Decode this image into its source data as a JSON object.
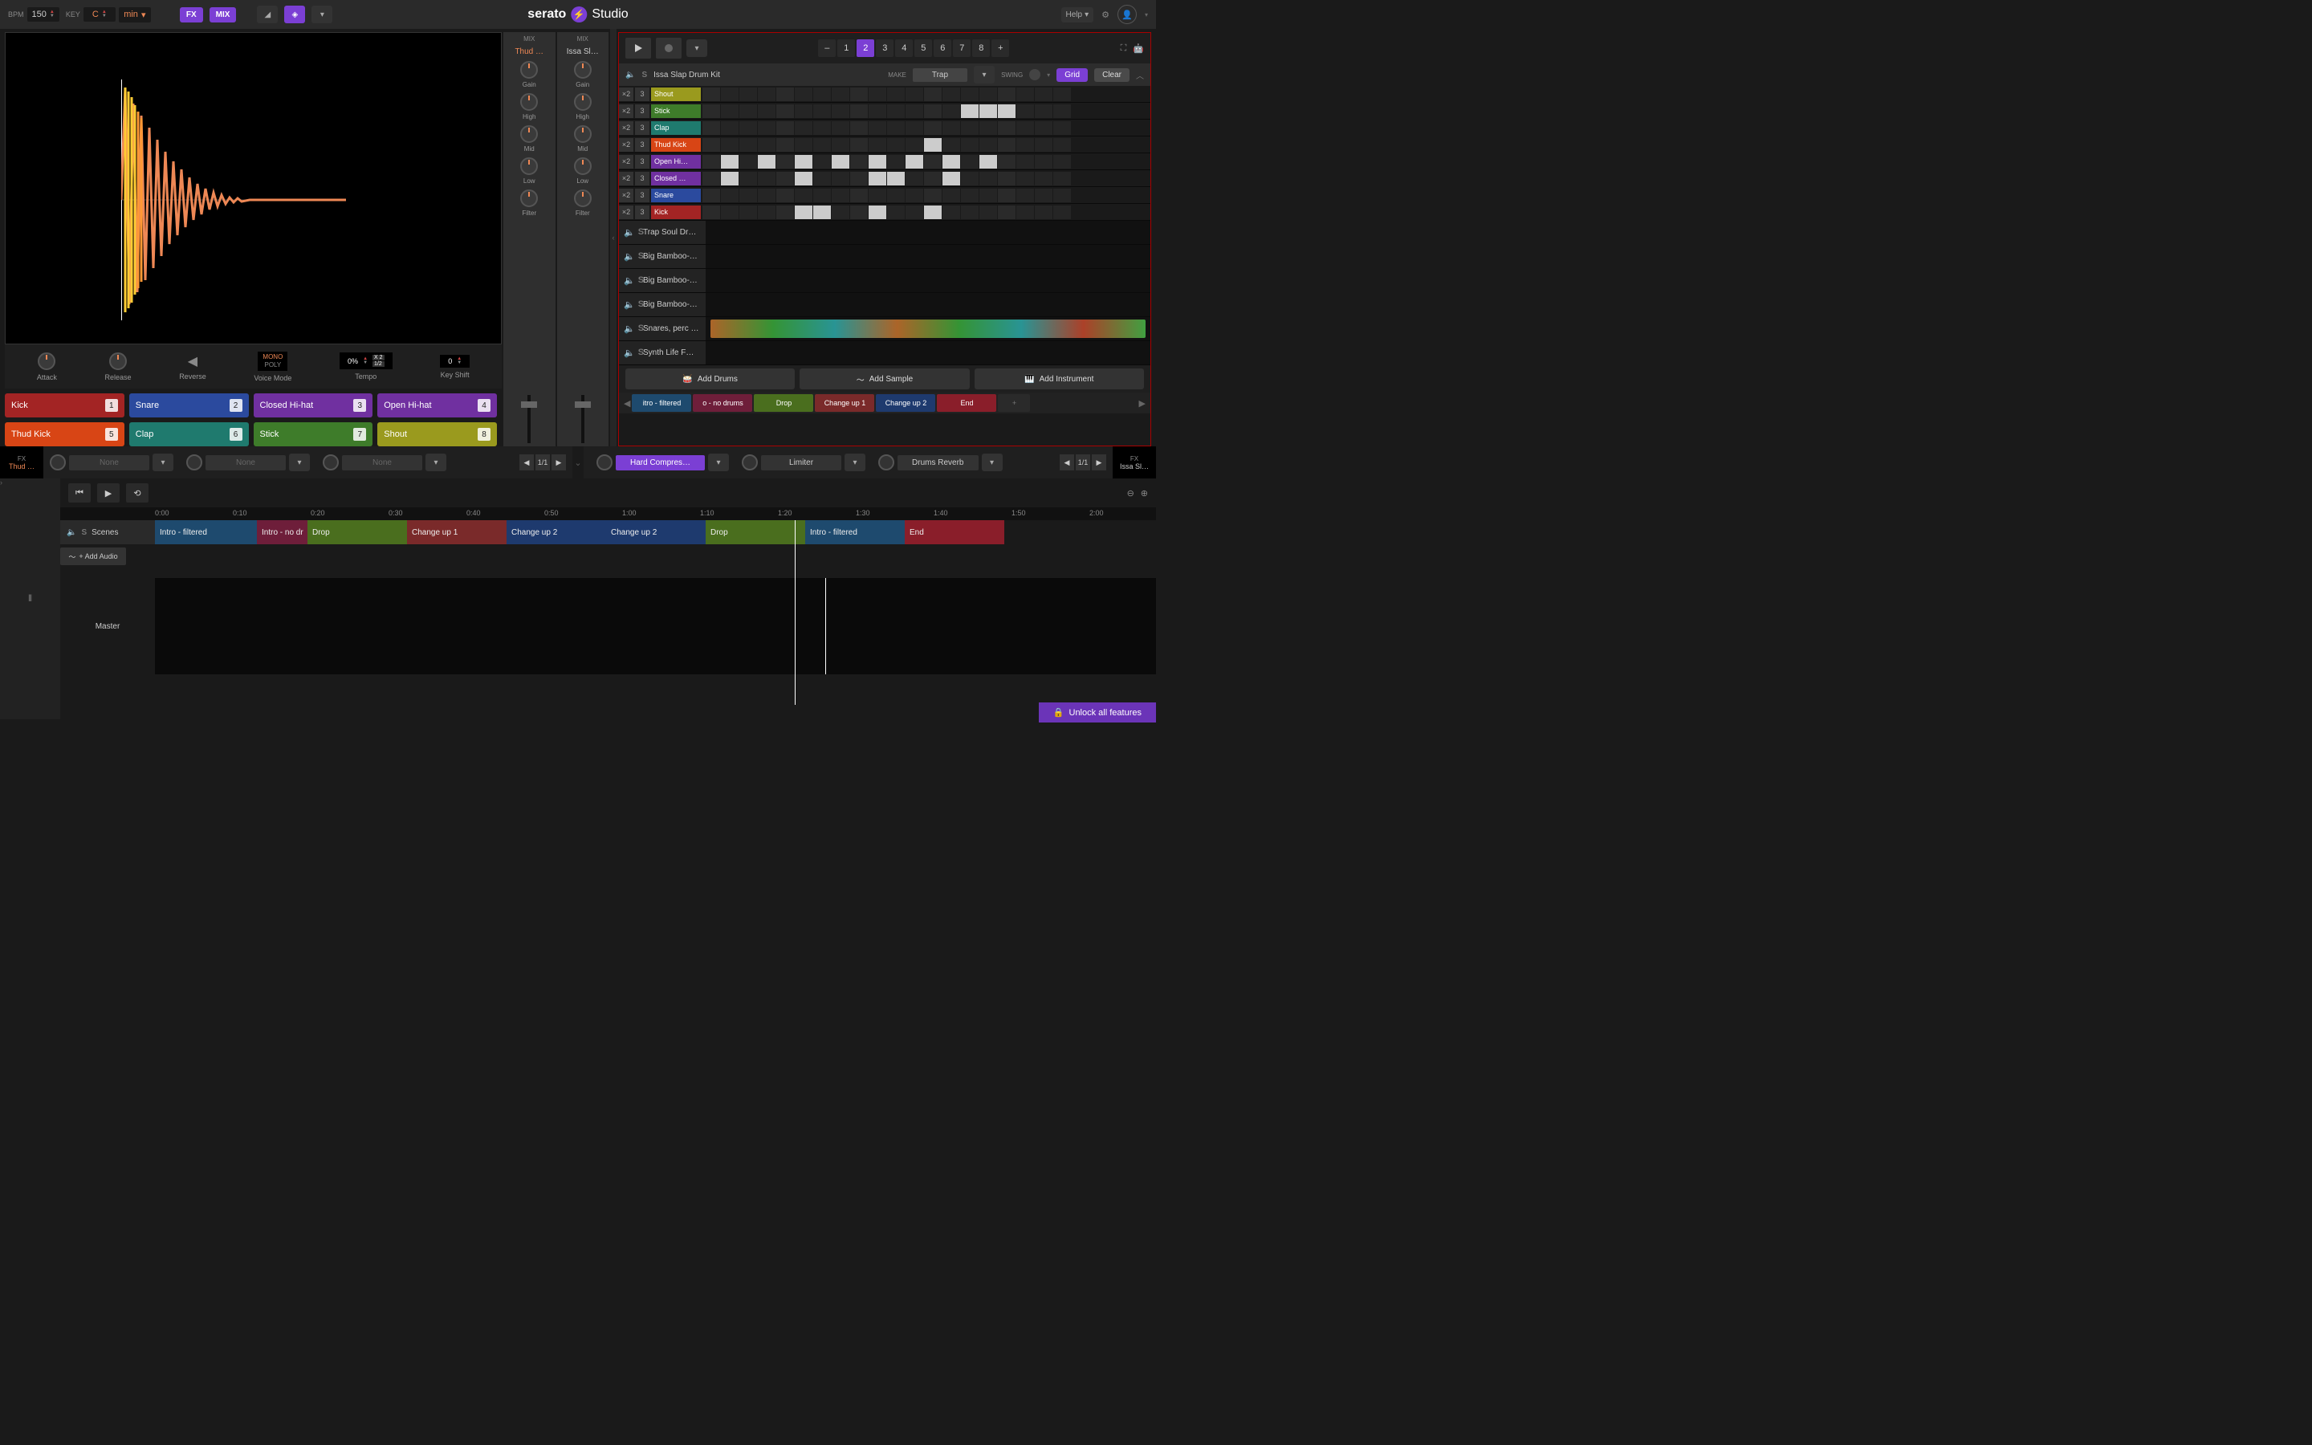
{
  "top": {
    "bpm_label": "BPM",
    "bpm_value": "150",
    "key_label": "KEY",
    "key_value": "C",
    "key_scale": "min",
    "fx": "FX",
    "mix": "MIX",
    "brand": "serato",
    "product": "Studio",
    "help": "Help"
  },
  "sample": {
    "attack": "Attack",
    "release": "Release",
    "reverse": "Reverse",
    "voice": "Voice Mode",
    "mono": "MONO",
    "poly": "POLY",
    "tempo": "Tempo",
    "tempo_val": "0%",
    "x2": "X 2",
    "half": "1/2",
    "keyshift": "Key Shift",
    "keyshift_val": "0"
  },
  "pads": [
    {
      "label": "Kick",
      "num": "1",
      "color": "#a32424"
    },
    {
      "label": "Snare",
      "num": "2",
      "color": "#2b4a9e"
    },
    {
      "label": "Closed Hi-hat",
      "num": "3",
      "color": "#7030a0"
    },
    {
      "label": "Open Hi-hat",
      "num": "4",
      "color": "#7030a0"
    },
    {
      "label": "Thud Kick",
      "num": "5",
      "color": "#d84515"
    },
    {
      "label": "Clap",
      "num": "6",
      "color": "#1f7a6e"
    },
    {
      "label": "Stick",
      "num": "7",
      "color": "#3e7c2a"
    },
    {
      "label": "Shout",
      "num": "8",
      "color": "#9a9a1e"
    }
  ],
  "strips": [
    {
      "mix": "MIX",
      "name": "Thud …",
      "red": true
    },
    {
      "mix": "MIX",
      "name": "Issa Sl…",
      "red": false
    }
  ],
  "strip_knobs": [
    "Gain",
    "High",
    "Mid",
    "Low",
    "Filter"
  ],
  "transport": {
    "scenes": [
      "1",
      "2",
      "3",
      "4",
      "5",
      "6",
      "7",
      "8"
    ],
    "active": "2",
    "minus": "–",
    "plus": "+"
  },
  "drumkit": {
    "name": "Issa Slap Drum Kit",
    "make": "MAKE",
    "genre": "Trap",
    "swing": "SWING",
    "grid": "Grid",
    "clear": "Clear"
  },
  "drum_rows": [
    {
      "label": "Shout",
      "color": "#9a9a1e",
      "steps": []
    },
    {
      "label": "Stick",
      "color": "#3e7c2a",
      "steps": [
        15,
        16,
        17
      ]
    },
    {
      "label": "Clap",
      "color": "#1f7a6e",
      "steps": []
    },
    {
      "label": "Thud Kick",
      "color": "#d84515",
      "steps": [
        13
      ]
    },
    {
      "label": "Open Hi…",
      "color": "#7030a0",
      "steps": [
        2,
        4,
        6,
        8,
        10,
        12,
        14,
        16
      ]
    },
    {
      "label": "Closed …",
      "color": "#7030a0",
      "steps": [
        2,
        6,
        10,
        11,
        14
      ]
    },
    {
      "label": "Snare",
      "color": "#2b4a9e",
      "steps": []
    },
    {
      "label": "Kick",
      "color": "#a32424",
      "steps": [
        6,
        7,
        10,
        13
      ]
    }
  ],
  "tracks": [
    {
      "name": "Trap Soul Dr…"
    },
    {
      "name": "Big Bamboo-…"
    },
    {
      "name": "Big Bamboo-…"
    },
    {
      "name": "Big Bamboo-…"
    },
    {
      "name": "Snares, perc …",
      "wave": true
    },
    {
      "name": "Synth Life F…"
    }
  ],
  "add": {
    "drums": "Add Drums",
    "sample": "Add Sample",
    "instrument": "Add Instrument"
  },
  "scene_tabs": [
    {
      "label": "itro - filtered",
      "color": "#1e4a6e"
    },
    {
      "label": "o - no drums",
      "color": "#6e1e3a"
    },
    {
      "label": "Drop",
      "color": "#4a6e1e"
    },
    {
      "label": "Change up 1",
      "color": "#7a2a2a"
    },
    {
      "label": "Change up 2",
      "color": "#1e3a6e"
    },
    {
      "label": "End",
      "color": "#8a1e2a"
    }
  ],
  "fx_left": {
    "title": "FX",
    "name": "Thud …"
  },
  "fx_right": {
    "title": "FX",
    "name": "Issa Sl…"
  },
  "fx_slots_left": [
    {
      "label": "None",
      "style": "dim"
    },
    {
      "label": "None",
      "style": "dim"
    },
    {
      "label": "None",
      "style": "dim"
    }
  ],
  "fx_slots_right": [
    {
      "label": "Hard Compres…",
      "style": "purple"
    },
    {
      "label": "Limiter",
      "style": ""
    },
    {
      "label": "Drums Reverb",
      "style": ""
    }
  ],
  "fx_page": "1/1",
  "timeline": {
    "scenes_label": "Scenes",
    "add_audio": "+ Add Audio",
    "master": "Master",
    "ticks": [
      "0:00",
      "0:10",
      "0:20",
      "0:30",
      "0:40",
      "0:50",
      "1:00",
      "1:10",
      "1:20",
      "1:30",
      "1:40",
      "1:50",
      "2:00"
    ],
    "blocks": [
      {
        "label": "Intro - filtered",
        "color": "#1e4a6e",
        "w": 127
      },
      {
        "label": "Intro - no dr",
        "color": "#6e1e3a",
        "w": 63
      },
      {
        "label": "Drop",
        "color": "#4a6e1e",
        "w": 124
      },
      {
        "label": "Change up 1",
        "color": "#7a2a2a",
        "w": 124
      },
      {
        "label": "Change up 2",
        "color": "#1e3a6e",
        "w": 124
      },
      {
        "label": "Change up 2",
        "color": "#1e3a6e",
        "w": 124
      },
      {
        "label": "Drop",
        "color": "#4a6e1e",
        "w": 124
      },
      {
        "label": "Intro - filtered",
        "color": "#1e4a6e",
        "w": 124
      },
      {
        "label": "End",
        "color": "#8a1e2a",
        "w": 124
      }
    ],
    "playhead_pct": 67
  },
  "unlock": "Unlock all features"
}
